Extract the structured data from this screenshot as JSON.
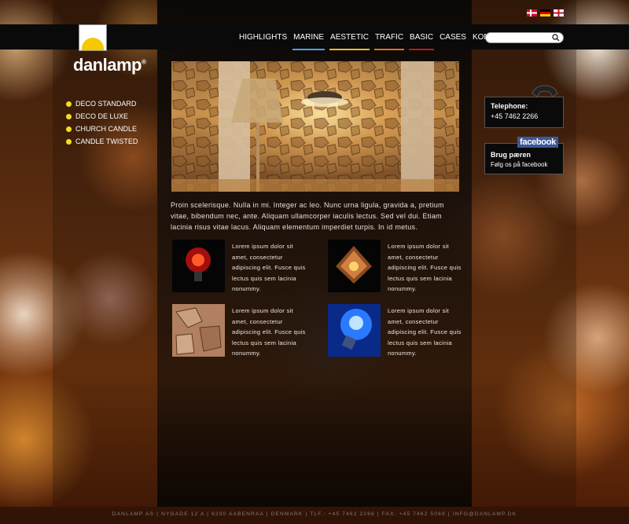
{
  "brand": {
    "name": "danlamp",
    "mark": "®"
  },
  "languages": [
    {
      "code": "da",
      "colors": [
        "#c8102e",
        "#ffffff"
      ]
    },
    {
      "code": "de",
      "colors": [
        "#000000",
        "#dd0000",
        "#ffce00"
      ]
    },
    {
      "code": "en",
      "colors": [
        "#ffffff",
        "#c8102e"
      ]
    }
  ],
  "nav": [
    {
      "label": "HIGHLIGHTS",
      "accent": ""
    },
    {
      "label": "MARINE",
      "accent": "#4fa3e0"
    },
    {
      "label": "AESTETIC",
      "accent": "#f0c020"
    },
    {
      "label": "TRAFIC",
      "accent": "#e07020"
    },
    {
      "label": "BASIC",
      "accent": "#c01818"
    },
    {
      "label": "CASES",
      "accent": ""
    },
    {
      "label": "KONTAKT",
      "accent": ""
    }
  ],
  "search": {
    "placeholder": "",
    "value": ""
  },
  "side_menu": [
    "DECO STANDARD",
    "DECO DE LUXE",
    "CHURCH CANDLE",
    "CANDLE TWISTED"
  ],
  "intro": "Proin scelerisque. Nulla in mi. Integer ac leo. Nunc urna ligula, gravida a, pretium vitae, bibendum nec, ante. Aliquam ullamcorper iaculis lectus. Sed vel dui. Etiam lacinia risus vitae lacus. Aliquam elementum imperdiet turpis. In id metus.",
  "products": [
    {
      "text": "Lorem ipsum dolor sit amet, consectetur adipiscing elit. Fusce quis lectus quis sem lacinia nonummy.",
      "image": "red-filament-bulb"
    },
    {
      "text": "Lorem ipsum dolor sit amet, consectetur adipiscing elit. Fusce quis lectus quis sem lacinia nonummy.",
      "image": "artichoke-lamp"
    },
    {
      "text": "Lorem ipsum dolor sit amet, consectetur adipiscing elit. Fusce quis lectus quis sem lacinia nonummy.",
      "image": "mosaic-panel"
    },
    {
      "text": "Lorem ipsum dolor sit amet, consectetur adipiscing elit. Fusce quis lectus quis sem lacinia nonummy.",
      "image": "blue-bulb"
    }
  ],
  "contact": {
    "label": "Telephone:",
    "number": "+45 7462 2266"
  },
  "facebook": {
    "logo": "facebook",
    "title": "Brug pæren",
    "subtitle": "Følg os på facebook"
  },
  "footer": "DANLAMP AS | NYGADE 12 A | 6200 AABENRAA | DENMARK | TLF.: +45 7462 2266 | FAX: +45 7462 5069 | INFO@DANLAMP.DK"
}
